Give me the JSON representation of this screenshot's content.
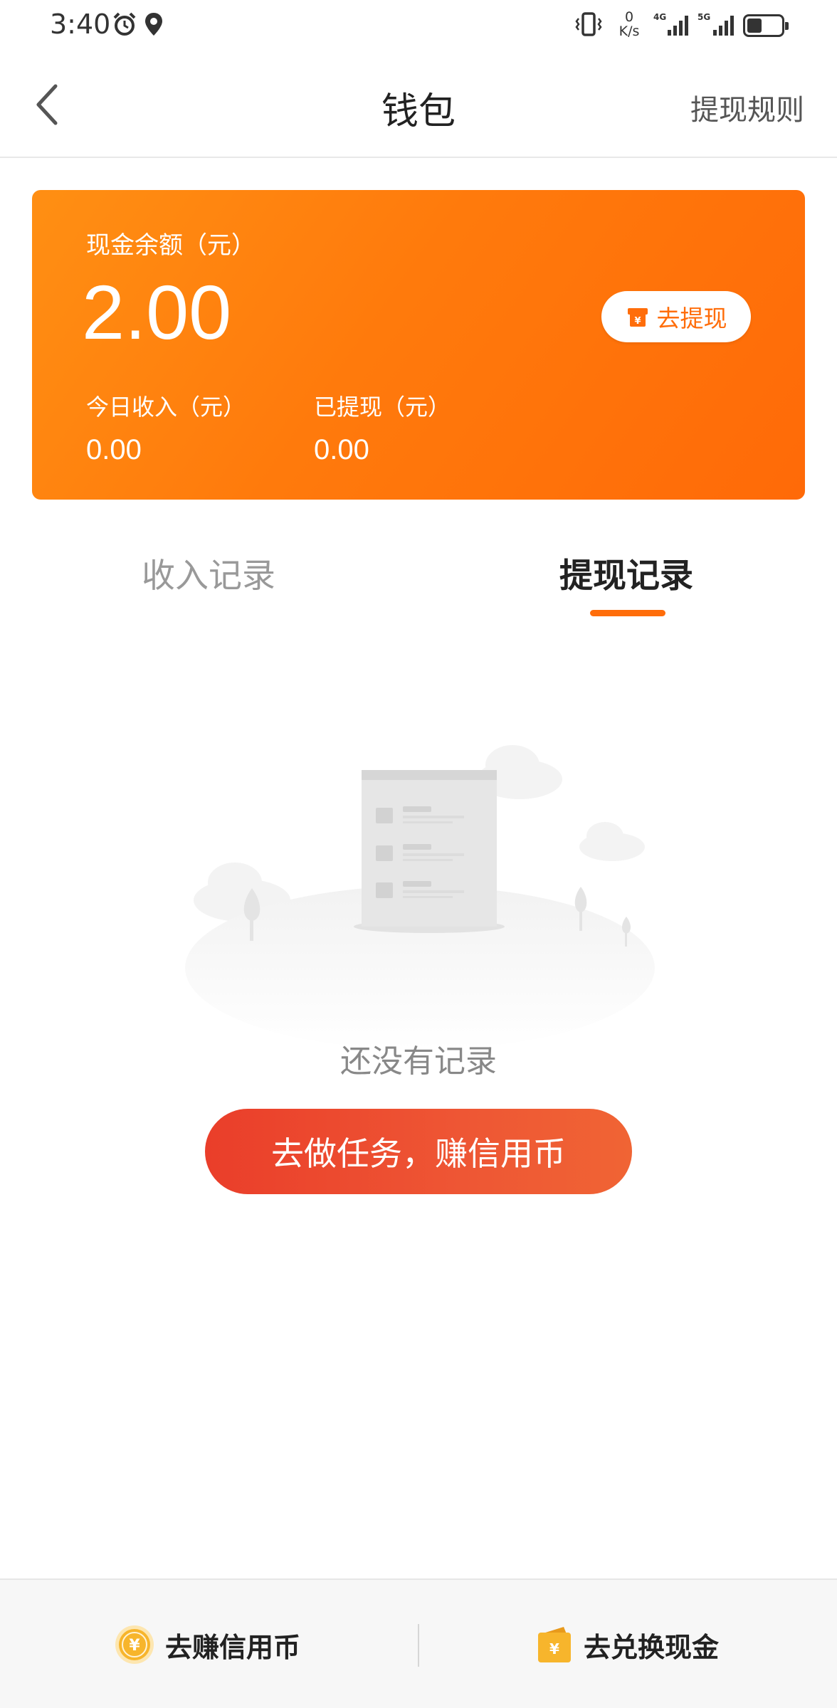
{
  "status_bar": {
    "time": "3:40",
    "net_speed_value": "0",
    "net_speed_unit": "K/s",
    "sim1_type": "4G",
    "sim2_type": "5G",
    "icons": [
      "alarm-icon",
      "location-icon",
      "vibrate-icon",
      "signal-icon",
      "battery-icon"
    ]
  },
  "navbar": {
    "title": "钱包",
    "rules_link": "提现规则"
  },
  "balance_card": {
    "label": "现金余额（元）",
    "amount": "2.00",
    "withdraw_button": "去提现",
    "today_income_label": "今日收入（元）",
    "today_income_value": "0.00",
    "withdrawn_label": "已提现（元）",
    "withdrawn_value": "0.00",
    "gradient_colors": [
      "#ff8f13",
      "#ff6a08"
    ]
  },
  "tabs": [
    {
      "label": "收入记录",
      "active": false
    },
    {
      "label": "提现记录",
      "active": true
    }
  ],
  "empty_state": {
    "message": "还没有记录",
    "action_button": "去做任务，赚信用币"
  },
  "bottom_bar": {
    "left_label": "去赚信用币",
    "right_label": "去兑换现金",
    "currency_symbol": "¥"
  },
  "colors": {
    "accent": "#ff6d0a",
    "action_red": "#ea3e2a",
    "coin_gold": "#f7b52c"
  }
}
